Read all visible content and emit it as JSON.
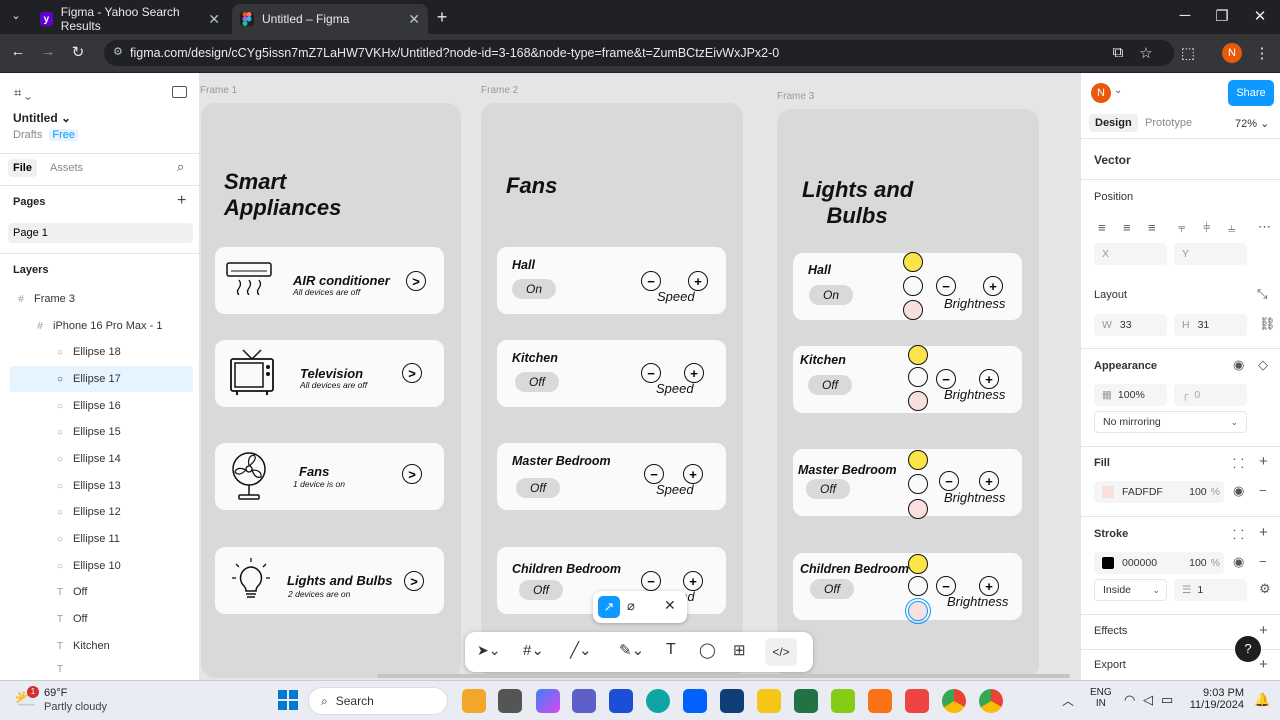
{
  "browser": {
    "tabs": [
      {
        "title": "Figma - Yahoo Search Results",
        "active": false
      },
      {
        "title": "Untitled – Figma",
        "active": true
      }
    ],
    "url": "figma.com/design/cCYg5issn7mZ7LaHW7VKHx/Untitled?node-id=3-168&node-type=frame&t=ZumBCtzEivWxJPx2-0",
    "profile_initial": "N"
  },
  "left_panel": {
    "file_name": "Untitled",
    "drafts": "Drafts",
    "plan": "Free",
    "tab_file": "File",
    "tab_assets": "Assets",
    "pages_title": "Pages",
    "page": "Page 1",
    "layers_title": "Layers",
    "layers": [
      {
        "name": "Frame 3",
        "icon": "#"
      },
      {
        "name": "iPhone 16 Pro Max - 1",
        "icon": "#"
      },
      {
        "name": "Ellipse 18",
        "icon": "○"
      },
      {
        "name": "Ellipse 17",
        "icon": "○"
      },
      {
        "name": "Ellipse 16",
        "icon": "○"
      },
      {
        "name": "Ellipse 15",
        "icon": "○"
      },
      {
        "name": "Ellipse 14",
        "icon": "○"
      },
      {
        "name": "Ellipse 13",
        "icon": "○"
      },
      {
        "name": "Ellipse 12",
        "icon": "○"
      },
      {
        "name": "Ellipse 11",
        "icon": "○"
      },
      {
        "name": "Ellipse 10",
        "icon": "○"
      },
      {
        "name": "Off",
        "icon": "T"
      },
      {
        "name": "Off",
        "icon": "T"
      },
      {
        "name": "Kitchen",
        "icon": "T"
      },
      {
        "name": "T",
        "icon": "T"
      }
    ]
  },
  "canvas": {
    "frame1": {
      "label": "Frame 1",
      "title": "Smart\nAppliances",
      "cards": [
        {
          "name": "AIR conditioner",
          "sub": "All devices are off"
        },
        {
          "name": "Television",
          "sub": "All devices are off"
        },
        {
          "name": "Fans",
          "sub": "1 device is on"
        },
        {
          "name": "Lights and Bulbs",
          "sub": "2 devices are on"
        }
      ]
    },
    "frame2": {
      "label": "Frame 2",
      "title": "Fans",
      "rooms": [
        {
          "name": "Hall",
          "state": "On",
          "control": "Speed"
        },
        {
          "name": "Kitchen",
          "state": "Off",
          "control": "Speed"
        },
        {
          "name": "Master Bedroom",
          "state": "Off",
          "control": "Speed"
        },
        {
          "name": "Children Bedroom",
          "state": "Off",
          "control": "Speed"
        }
      ]
    },
    "frame3": {
      "label": "Frame 3",
      "title": "Lights and\n    Bulbs",
      "rooms": [
        {
          "name": "Hall",
          "state": "On",
          "control": "Brightness"
        },
        {
          "name": "Kitchen",
          "state": "Off",
          "control": "Brightness"
        },
        {
          "name": "Master Bedroom",
          "state": "Off",
          "control": "Brightness"
        },
        {
          "name": "Children Bedroom",
          "state": "Off",
          "control": "Brightness"
        }
      ]
    },
    "minus": "−",
    "plus": "+",
    "arrow": ">"
  },
  "right_panel": {
    "avatar": "N",
    "share": "Share",
    "tab_design": "Design",
    "tab_prototype": "Prototype",
    "zoom": "72%",
    "selection": "Vector",
    "position": "Position",
    "x_label": "X",
    "y_label": "Y",
    "layout": "Layout",
    "w_label": "W",
    "w_value": "33",
    "h_label": "H",
    "h_value": "31",
    "appearance": "Appearance",
    "opacity": "100%",
    "radius": "0",
    "mirroring": "No mirroring",
    "fill": "Fill",
    "fill_hex": "FADFDF",
    "fill_opacity": "100",
    "pct": "%",
    "stroke": "Stroke",
    "stroke_hex": "000000",
    "stroke_opacity": "100",
    "stroke_position": "Inside",
    "stroke_weight": "1",
    "effects": "Effects",
    "export": "Export",
    "help": "?"
  },
  "taskbar": {
    "weather_temp": "69°F",
    "weather_desc": "Partly cloudy",
    "weather_badge": "1",
    "search": "Search",
    "lang1": "ENG",
    "lang2": "IN",
    "time": "9:03 PM",
    "date": "11/19/2024"
  },
  "colors": {
    "yellow": "#fbe44a",
    "pink": "#fadfdf",
    "figma_blue": "#0d99ff",
    "avatar_orange": "#e8590c"
  }
}
